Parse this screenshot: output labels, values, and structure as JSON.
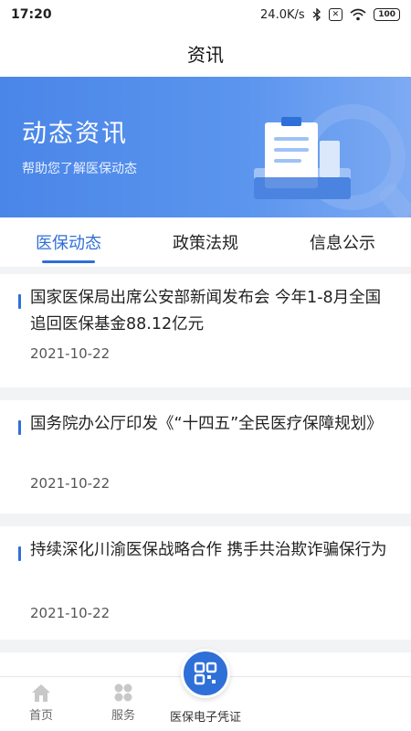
{
  "status_bar": {
    "time": "17:20",
    "speed": "24.0K/s",
    "battery": "100"
  },
  "app_bar": {
    "title": "资讯"
  },
  "banner": {
    "title": "动态资讯",
    "subtitle": "帮助您了解医保动态"
  },
  "tabs": [
    {
      "label": "医保动态",
      "active": true
    },
    {
      "label": "政策法规",
      "active": false
    },
    {
      "label": "信息公示",
      "active": false
    }
  ],
  "news": [
    {
      "headline": "国家医保局出席公安部新闻发布会 今年1-8月全国追回医保基金88.12亿元",
      "date": "2021-10-22"
    },
    {
      "headline": "国务院办公厅印发《“十四五”全民医疗保障规划》",
      "date": "2021-10-22"
    },
    {
      "headline": "持续深化川渝医保战略合作 携手共治欺诈骗保行为",
      "date": "2021-10-22"
    }
  ],
  "bottom_nav": {
    "home_label": "首页",
    "service_label": "服务",
    "center_label": "医保电子凭证"
  },
  "colors": {
    "accent": "#2f6fd8",
    "banner": "#4a86e8"
  }
}
